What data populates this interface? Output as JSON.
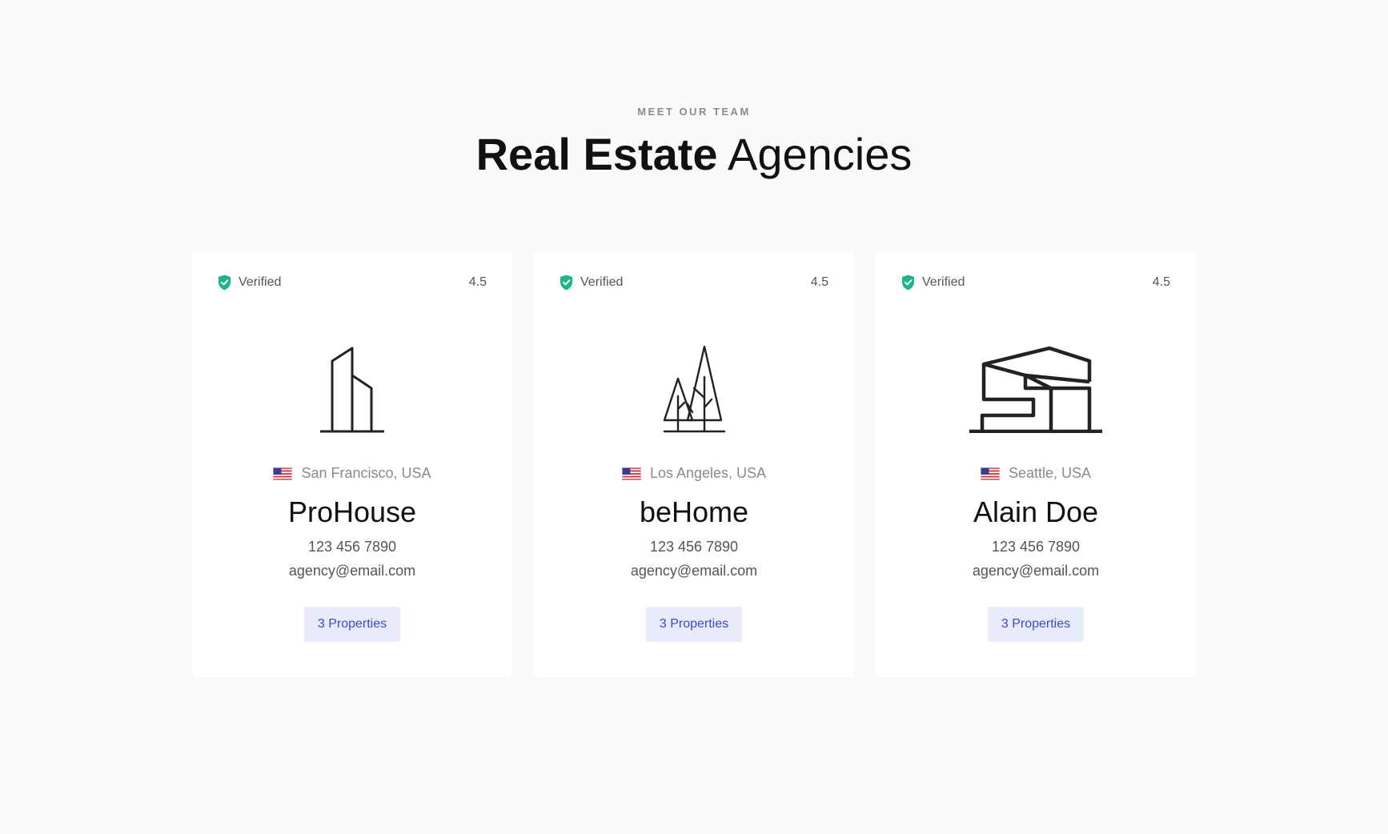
{
  "section": {
    "eyebrow": "MEET OUR TEAM",
    "title_bold": "Real Estate",
    "title_light": "Agencies"
  },
  "colors": {
    "verified_green": "#1fb48c",
    "button_bg": "#e8ebfa",
    "button_text": "#3b4bc8"
  },
  "cards": [
    {
      "badge": "Verified",
      "rating": "4.5",
      "logo_icon": "tall-building-icon",
      "flag_icon": "us-flag-icon",
      "location": "San Francisco, USA",
      "name": "ProHouse",
      "phone": "123 456 7890",
      "email": "agency@email.com",
      "properties_label": "3 Properties"
    },
    {
      "badge": "Verified",
      "rating": "4.5",
      "logo_icon": "trees-icon",
      "flag_icon": "us-flag-icon",
      "location": "Los Angeles, USA",
      "name": "beHome",
      "phone": "123 456 7890",
      "email": "agency@email.com",
      "properties_label": "3 Properties"
    },
    {
      "badge": "Verified",
      "rating": "4.5",
      "logo_icon": "modern-house-icon",
      "flag_icon": "us-flag-icon",
      "location": "Seattle, USA",
      "name": "Alain Doe",
      "phone": "123 456 7890",
      "email": "agency@email.com",
      "properties_label": "3 Properties"
    }
  ]
}
